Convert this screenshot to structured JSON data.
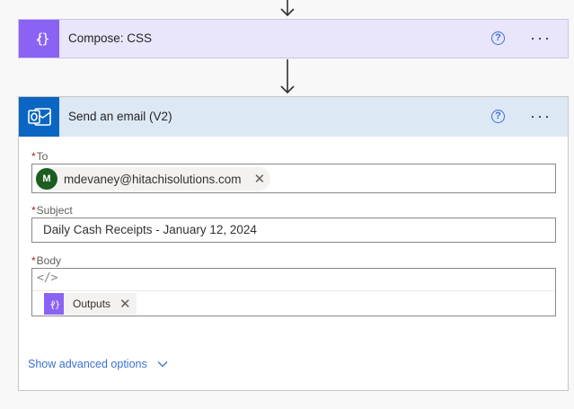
{
  "compose": {
    "title": "Compose: CSS",
    "icon": "curly-braces-icon",
    "accent": "#8a63f5"
  },
  "email": {
    "title": "Send an email (V2)",
    "icon": "outlook-icon",
    "accent": "#0a66c2",
    "to": {
      "label": "To",
      "recipient_initial": "M",
      "recipient": "mdevaney@hitachisolutions.com"
    },
    "subject": {
      "label": "Subject",
      "value": "Daily Cash Receipts - January 12, 2024"
    },
    "body": {
      "label": "Body",
      "code_icon": "</>",
      "token": "Outputs"
    },
    "advanced_label": "Show advanced options"
  },
  "common": {
    "required_mark": "*",
    "help_glyph": "?",
    "more_glyph": "···",
    "remove_glyph": "✕"
  }
}
